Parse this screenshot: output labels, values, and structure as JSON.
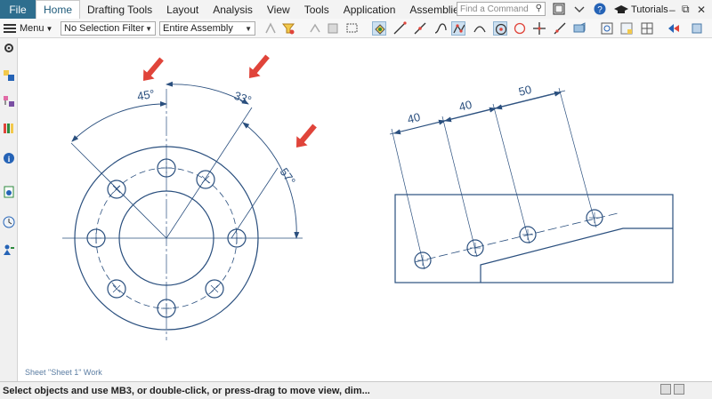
{
  "menubar": {
    "file_label": "File",
    "tabs": [
      {
        "label": "Home",
        "active": true
      },
      {
        "label": "Drafting Tools"
      },
      {
        "label": "Layout"
      },
      {
        "label": "Analysis"
      },
      {
        "label": "View"
      },
      {
        "label": "Tools"
      },
      {
        "label": "Application"
      },
      {
        "label": "Assemblies"
      }
    ],
    "search_placeholder": "Find a Command",
    "tutorials_label": "Tutorials"
  },
  "toolbar": {
    "menu_label": "Menu",
    "selection_filter": "No Selection Filter",
    "scope": "Entire Assembly"
  },
  "drawing": {
    "sheet_label": "Sheet \"Sheet 1\" Work",
    "angular_dims": [
      "45°",
      "33°",
      "57°"
    ],
    "linear_dims": [
      "40",
      "40",
      "50"
    ]
  },
  "status": {
    "message": "Select objects and use MB3, or double-click, or press-drag to move view, dim..."
  },
  "colors": {
    "drawing_line": "#2a4f7e",
    "arrow_red": "#e0443a",
    "file_tab": "#2e6e8e"
  }
}
